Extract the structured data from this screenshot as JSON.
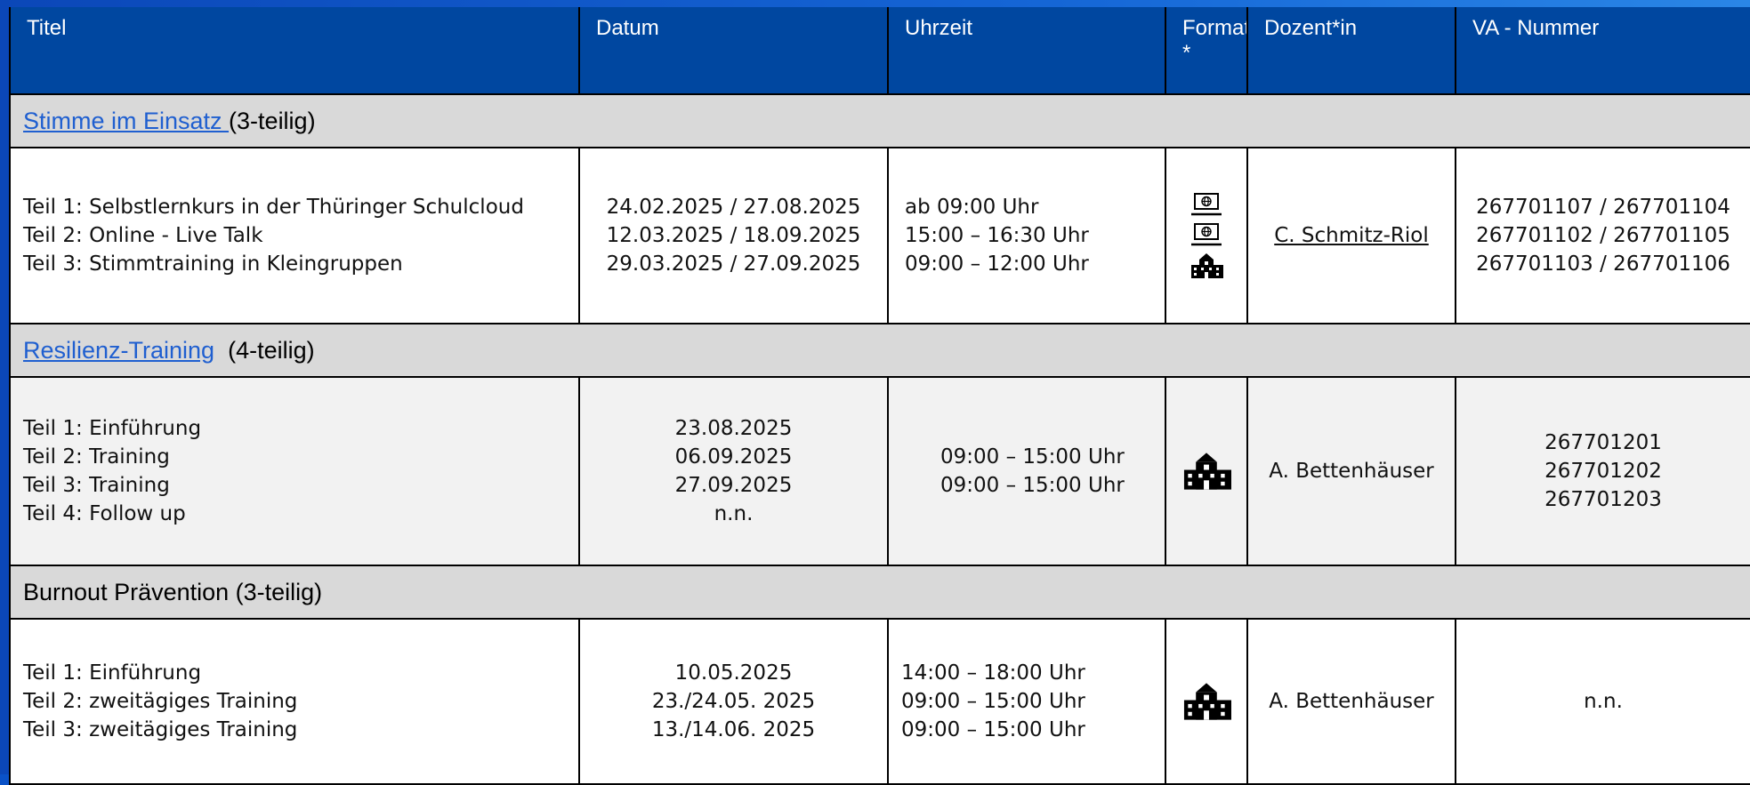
{
  "header": {
    "titel": "Titel",
    "datum": "Datum",
    "uhrzeit": "Uhrzeit",
    "format_line1": "Format",
    "format_line2": "*",
    "dozent": "Dozent*in",
    "va_nummer": "VA - Nummer"
  },
  "groups": [
    {
      "link": "Stimme im Einsatz ",
      "suffix": " (3-teilig)",
      "titles": [
        "Teil 1:  Selbstlernkurs in der Thüringer Schulcloud",
        "Teil 2:  Online - Live Talk",
        "Teil 3:  Stimmtraining in Kleingruppen"
      ],
      "dates": [
        "24.02.2025 / 27.08.2025",
        "12.03.2025 / 18.09.2025",
        "29.03.2025 / 27.09.2025"
      ],
      "times": [
        "ab 09:00 Uhr",
        "15:00 – 16:30 Uhr",
        "09:00 – 12:00 Uhr"
      ],
      "formats": [
        "laptop-globe-icon",
        "laptop-globe-icon",
        "school-building-icon"
      ],
      "dozent": "C. Schmitz-Riol",
      "va": [
        "267701107 / 267701104",
        "267701102 / 267701105",
        "267701103 / 267701106"
      ]
    },
    {
      "link": "Resilienz-Training",
      "suffix": "  (4-teilig)",
      "titles": [
        "Teil 1:  Einführung",
        "Teil 2:  Training",
        "Teil 3:  Training",
        "Teil 4:  Follow up"
      ],
      "dates": [
        "23.08.2025",
        "06.09.2025",
        "27.09.2025",
        "n.n."
      ],
      "times": [
        "09:00 – 15:00 Uhr",
        "09:00 – 15:00 Uhr"
      ],
      "formats": [
        "school-building-icon"
      ],
      "dozent": "A. Bettenhäuser",
      "va": [
        "267701201",
        "267701202",
        "267701203"
      ]
    },
    {
      "title": "Burnout Prävention (3-teilig)",
      "titles": [
        "Teil 1:  Einführung",
        "Teil 2:  zweitägiges Training",
        "Teil 3:  zweitägiges Training"
      ],
      "dates": [
        "10.05.2025",
        "23./24.05. 2025",
        "13./14.06. 2025"
      ],
      "times": [
        "14:00 – 18:00 Uhr",
        "09:00 – 15:00 Uhr",
        "09:00 – 15:00 Uhr"
      ],
      "formats": [
        "school-building-icon"
      ],
      "dozent": "A. Bettenhäuser",
      "va": [
        "n.n."
      ]
    }
  ],
  "colors": {
    "header_bg": "#0047a0",
    "group_bg": "#d9d9d9",
    "link": "#1f5fd0"
  }
}
